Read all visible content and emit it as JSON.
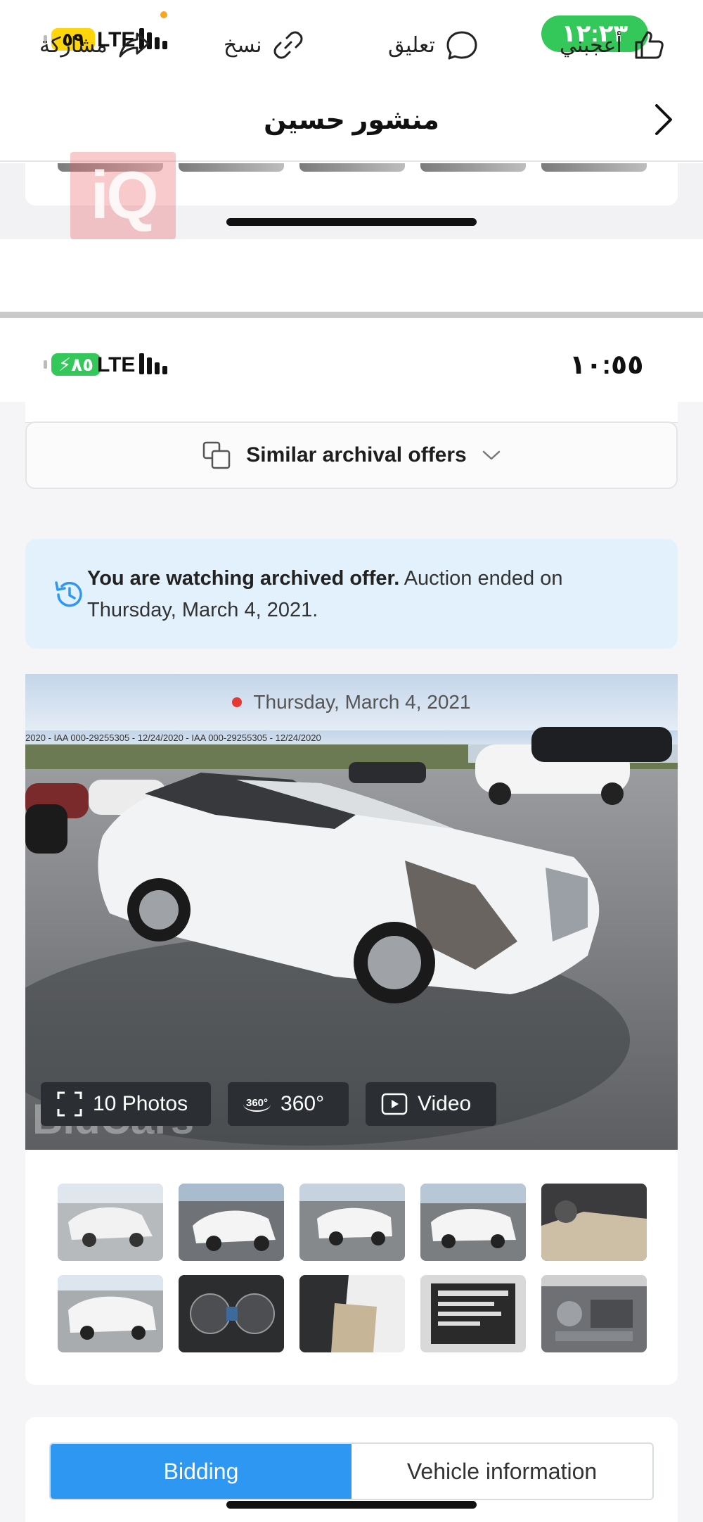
{
  "status_top": {
    "battery": "٥٩",
    "network": "LTE",
    "time": "١٢:٢٣",
    "accent": "#34c759"
  },
  "post": {
    "author": "منشور حسين",
    "back_icon": "chevron-right-icon"
  },
  "actions": {
    "like": "أعجبني",
    "comment": "تعليق",
    "copy": "نسخ",
    "share": "مشاركة"
  },
  "status_app": {
    "battery": "٨٥",
    "network": "LTE",
    "time": "١٠:٥٥"
  },
  "similar": {
    "label": "Similar archival offers"
  },
  "notice": {
    "bold": "You are watching archived offer.",
    "rest": " Auction ended on Thursday, March 4, 2021.",
    "color": "#e3f1fd"
  },
  "gallery": {
    "date": "Thursday, March 4, 2021",
    "photos_button": "10 Photos",
    "spin_button": "360°",
    "spin_icon_text": "360°",
    "video_button": "Video",
    "watermark": "BidCars",
    "photo_overlay_text": "2020 - IAA    000-29255305 - 12/24/2020 - IAA    000-29255305 - 12/24/2020",
    "thumbnail_count": 10
  },
  "tabs": {
    "active": "Bidding",
    "inactive": "Vehicle information",
    "accent": "#2e97f2"
  }
}
